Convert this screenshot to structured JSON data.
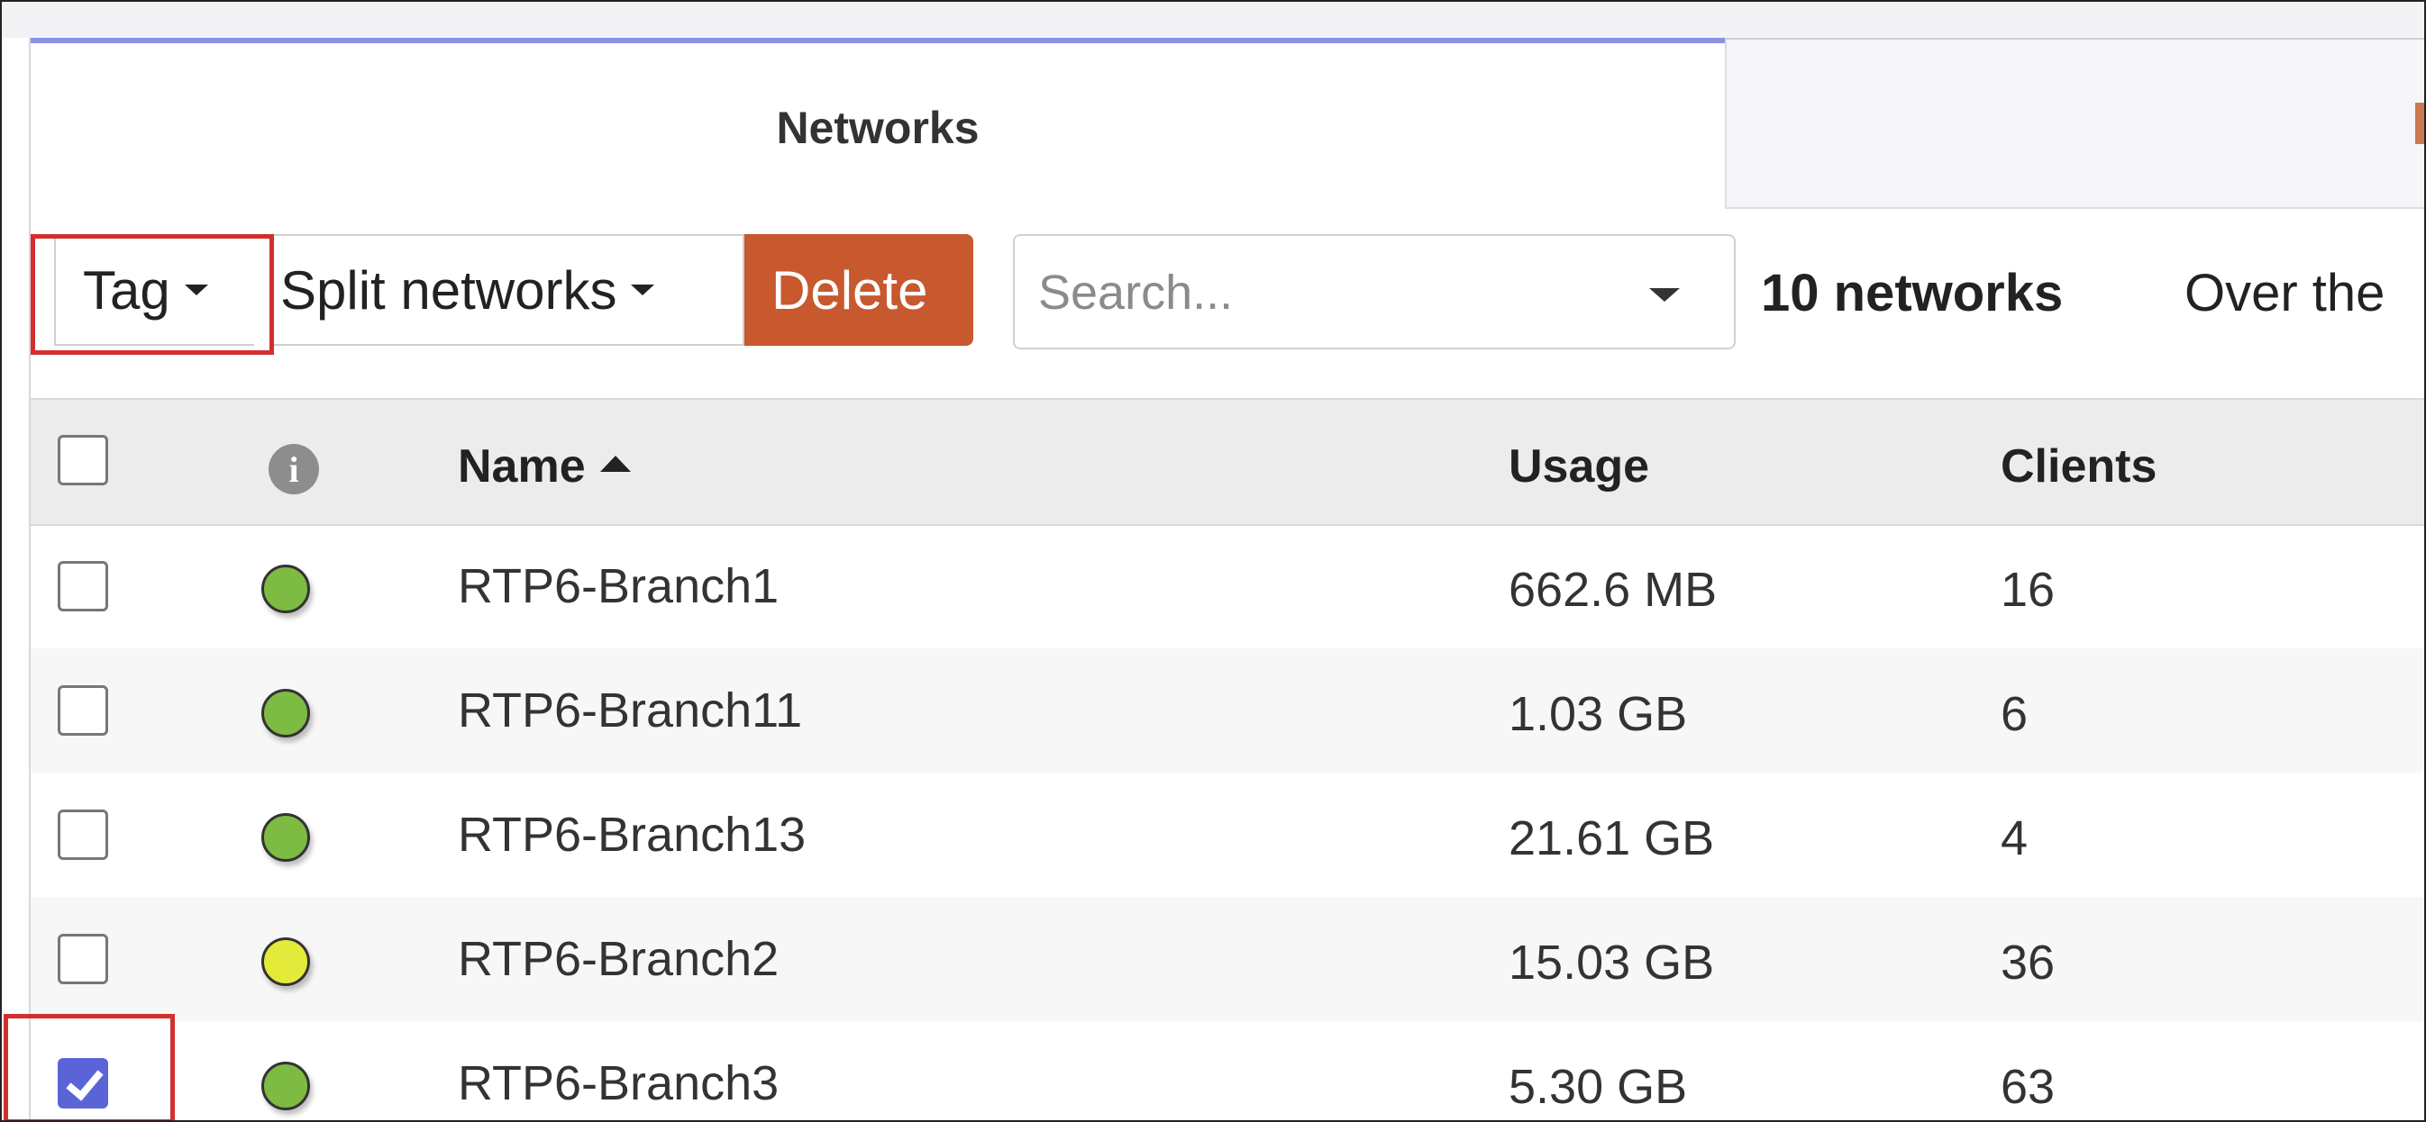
{
  "tabs": {
    "networks_label": "Networks"
  },
  "toolbar": {
    "tag_label": "Tag",
    "split_label": "Split networks",
    "delete_label": "Delete",
    "search_placeholder": "Search...",
    "count_text": "10 networks",
    "over_text": "Over the"
  },
  "colors": {
    "accent": "#5b64d6",
    "delete": "#c8582e",
    "tab_indicator": "#8a92e6",
    "highlight": "#d32f2f"
  },
  "table": {
    "headers": {
      "name": "Name",
      "usage": "Usage",
      "clients": "Clients",
      "info_icon": "info-icon"
    },
    "rows": [
      {
        "name": "RTP6-Branch1",
        "usage": "662.6 MB",
        "clients": "16",
        "status": "green",
        "checked": false
      },
      {
        "name": "RTP6-Branch11",
        "usage": "1.03 GB",
        "clients": "6",
        "status": "green",
        "checked": false
      },
      {
        "name": "RTP6-Branch13",
        "usage": "21.61 GB",
        "clients": "4",
        "status": "green",
        "checked": false
      },
      {
        "name": "RTP6-Branch2",
        "usage": "15.03 GB",
        "clients": "36",
        "status": "yellow",
        "checked": false
      },
      {
        "name": "RTP6-Branch3",
        "usage": "5.30 GB",
        "clients": "63",
        "status": "green",
        "checked": true
      }
    ]
  }
}
